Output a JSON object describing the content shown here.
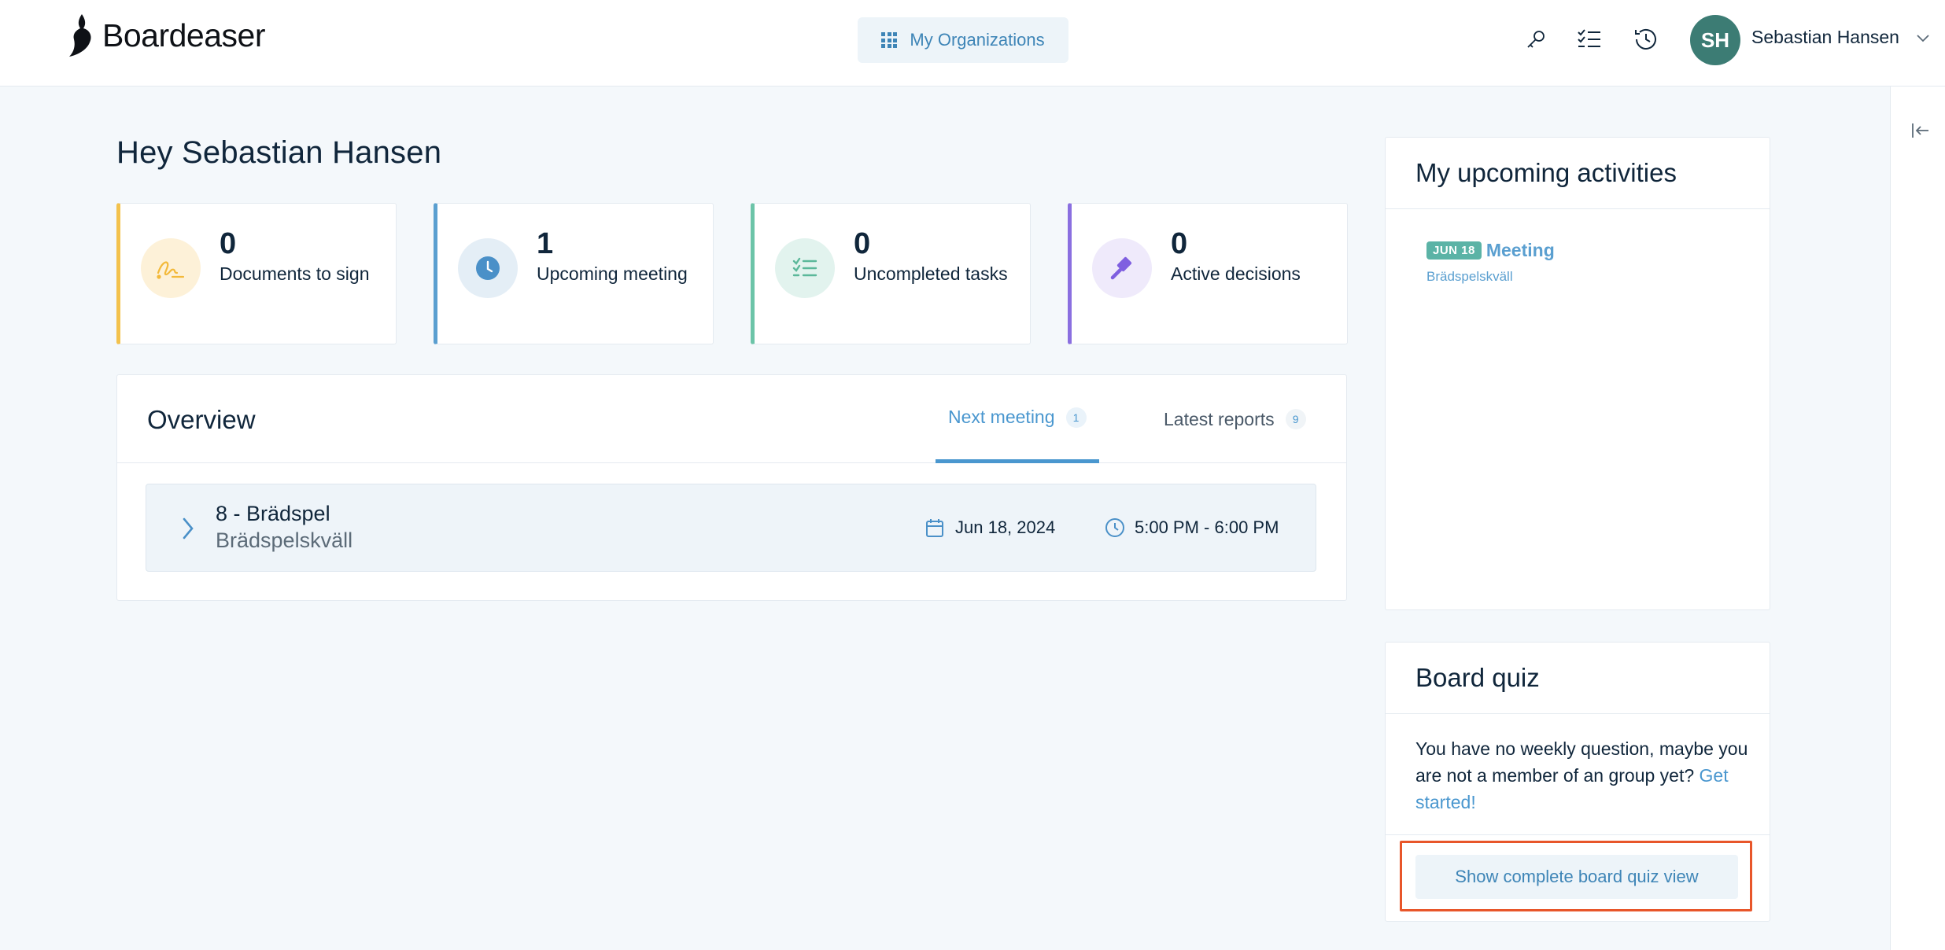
{
  "brand": {
    "name": "Boardeaser"
  },
  "header": {
    "org_button_label": "My Organizations",
    "icons": [
      "key-icon",
      "checklist-icon",
      "history-icon"
    ],
    "user": {
      "initials": "SH",
      "name": "Sebastian Hansen"
    }
  },
  "greeting": "Hey Sebastian Hansen",
  "stats": [
    {
      "value": "0",
      "label": "Documents to sign",
      "icon": "signature-icon",
      "accent": "#f3c24c"
    },
    {
      "value": "1",
      "label": "Upcoming meeting",
      "icon": "clock-icon",
      "accent": "#5a9fd0"
    },
    {
      "value": "0",
      "label": "Uncompleted tasks",
      "icon": "task-list-icon",
      "accent": "#6cc4a8"
    },
    {
      "value": "0",
      "label": "Active decisions",
      "icon": "gavel-icon",
      "accent": "#8a6fe0"
    }
  ],
  "overview": {
    "title": "Overview",
    "tabs": [
      {
        "label": "Next meeting",
        "count": "1",
        "active": true
      },
      {
        "label": "Latest reports",
        "count": "9",
        "active": false
      }
    ],
    "meeting": {
      "title": "8 - Brädspel",
      "subtitle": "Brädspelskväll",
      "date": "Jun 18, 2024",
      "time": "5:00 PM - 6:00 PM"
    }
  },
  "activities": {
    "title": "My upcoming activities",
    "items": [
      {
        "date_badge": "JUN 18",
        "title": "Meeting",
        "subtitle": "Brädspelskväll"
      }
    ]
  },
  "quiz": {
    "title": "Board quiz",
    "text": "You have no weekly question, maybe you are not a member of an group yet?",
    "link": "Get started!",
    "button_label": "Show complete board quiz view"
  }
}
